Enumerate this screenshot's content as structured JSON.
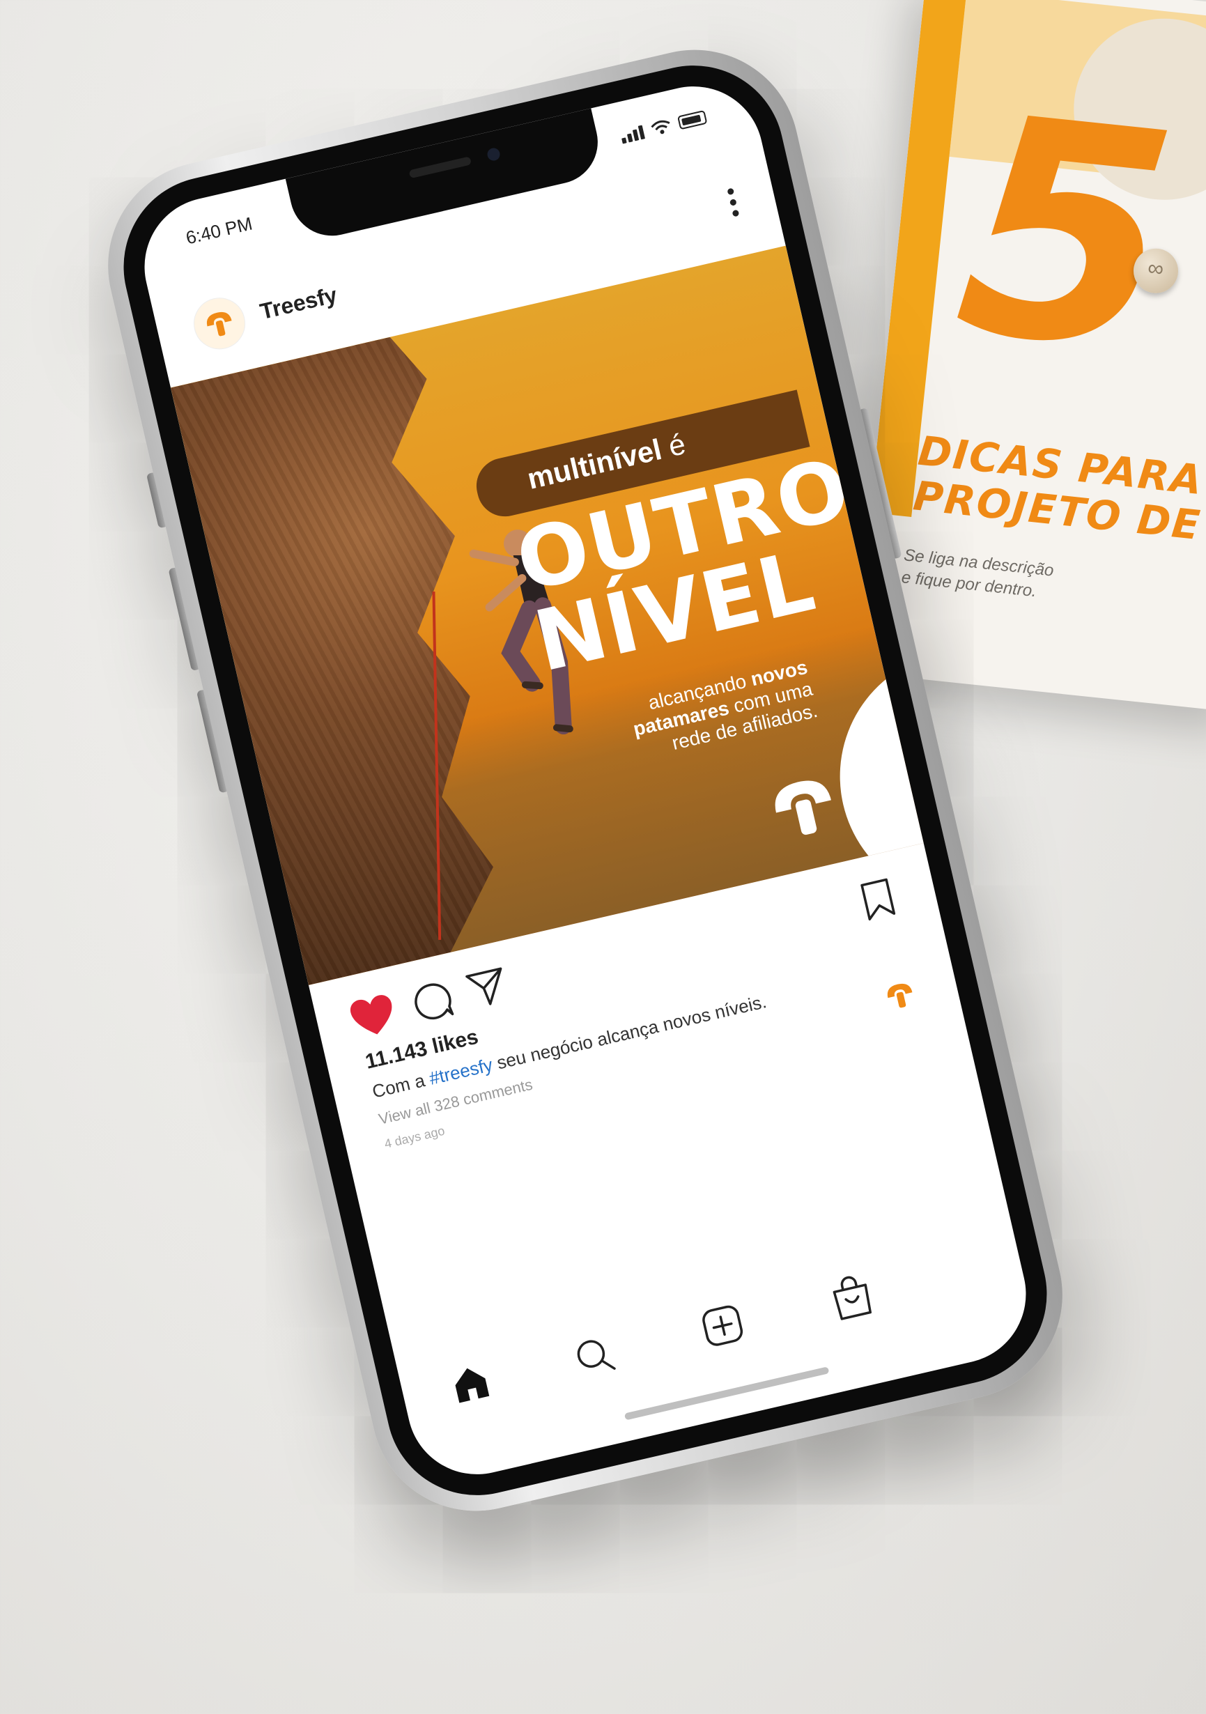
{
  "background_card": {
    "big_number": "5",
    "line1": "DICAS PARA",
    "line2": "PROJETO DE",
    "subtitle_line1": "Se liga na descrição",
    "subtitle_line2": "e fique por dentro."
  },
  "status_bar": {
    "time": "6:40 PM"
  },
  "post": {
    "username": "Treesfy",
    "image": {
      "headline_prefix_bold": "multinível",
      "headline_prefix_rest": " é",
      "headline_line1": "OUTRO",
      "headline_line2": "NÍVEL",
      "sub_part1": "alcançando ",
      "sub_bold1": "novos",
      "sub_bold2": "patamares",
      "sub_part2": " com uma",
      "sub_part3": "rede de afiliados."
    },
    "likes": "11.143 likes",
    "caption_prefix": "Com a ",
    "caption_hashtag": "#treesfy",
    "caption_rest": " seu negócio alcança novos níveis.",
    "comments_link": "View all 328 comments",
    "time_ago": "4 days ago"
  },
  "colors": {
    "brand_orange": "#f08a15",
    "like_red": "#e0243a",
    "hashtag_blue": "#2672c9"
  },
  "icons": [
    "more-vertical-icon",
    "heart-icon",
    "comment-icon",
    "share-icon",
    "bookmark-icon",
    "home-icon",
    "search-icon",
    "add-post-icon",
    "shop-icon",
    "treesfy-logo-icon"
  ]
}
